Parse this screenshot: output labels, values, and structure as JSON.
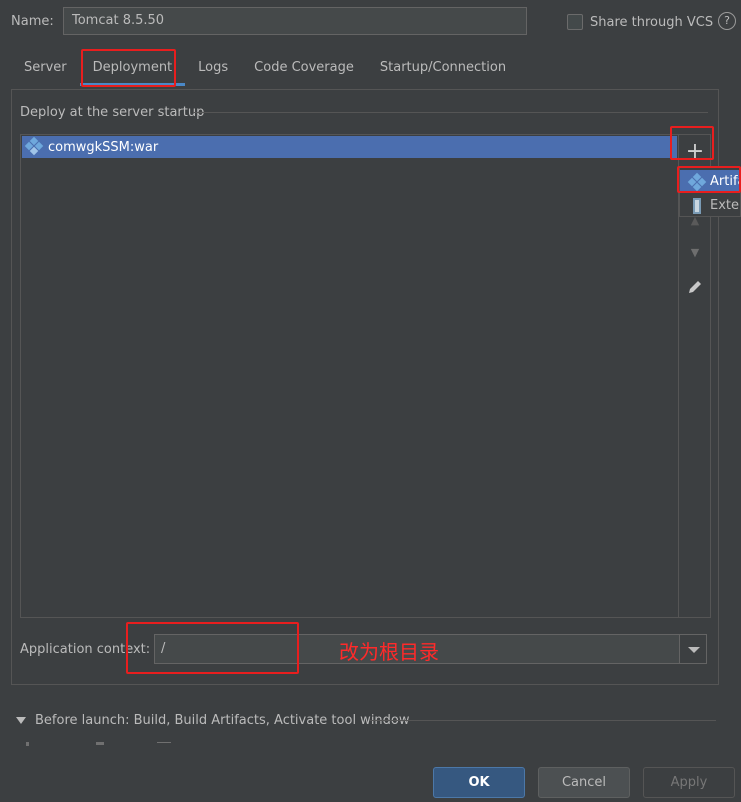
{
  "header": {
    "name_label": "Name:",
    "name_value": "Tomcat 8.5.50",
    "share_label": "Share through VCS",
    "help_glyph": "?"
  },
  "tabs": [
    {
      "label": "Server"
    },
    {
      "label": "Deployment",
      "active": true
    },
    {
      "label": "Logs"
    },
    {
      "label": "Code Coverage"
    },
    {
      "label": "Startup/Connection"
    }
  ],
  "deploy": {
    "section_title": "Deploy at the server startup",
    "items": [
      {
        "label": "comwgkSSM:war",
        "selected": true
      }
    ],
    "toolbar": {
      "plus": "+",
      "up": "▲",
      "down": "▼",
      "edit": "pencil-icon"
    }
  },
  "popup": {
    "items": [
      {
        "label": "Artifact...",
        "icon": "artifact-icon",
        "selected": true
      },
      {
        "label": "External Source...",
        "icon": "external-source-icon"
      }
    ]
  },
  "context": {
    "label": "Application context:",
    "value": "/",
    "annotation": "改为根目录"
  },
  "before_launch": {
    "label": "Before launch: Build, Build Artifacts, Activate tool window"
  },
  "buttons": {
    "ok": "OK",
    "cancel": "Cancel",
    "apply": "Apply"
  },
  "colors": {
    "background": "#3c3f41",
    "selection": "#4b6eaf",
    "highlight_box": "#e81e1e",
    "ok_button": "#365880"
  }
}
